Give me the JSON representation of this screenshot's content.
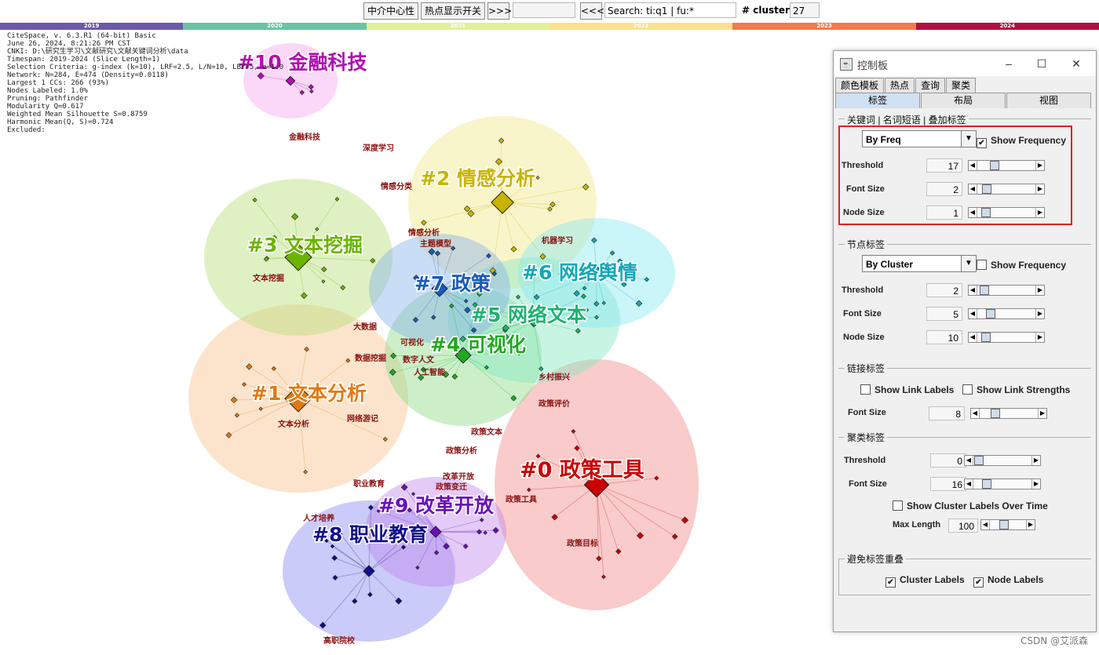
{
  "toolbar": {
    "centrality_btn": "中介中心性",
    "hotspot_btn": "热点显示开关",
    "next_btn": ">>>",
    "blank_field": "",
    "prev_btn": "<<<",
    "search_value": "Search: ti:q1 | fu:*",
    "clusters_label": "# clusters",
    "clusters_value": "27"
  },
  "timeline": {
    "years": [
      "2019",
      "2020",
      "2021",
      "2022",
      "2023",
      "2024"
    ],
    "colors": [
      "#6b5aa8",
      "#6cc3a0",
      "#dff09a",
      "#fde08f",
      "#f47a50",
      "#b01040"
    ]
  },
  "info": {
    "lines": [
      "CiteSpace, v. 6.3.R1 (64-bit) Basic",
      "June 26, 2024, 8:21:26 PM CST",
      "CNKI: D:\\研究生学习\\文献研究\\文献关键词分析\\data",
      "Timespan: 2019-2024 (Slice Length=1)",
      "Selection Criteria: g-index (k=10), LRF=2.5, L/N=10, LBY=5, e=1.0",
      "Network: N=284, E=474 (Density=0.0118)",
      "Largest 1 CCs: 266 (93%)",
      "Nodes Labeled: 1.0%",
      "Pruning: Pathfinder",
      "Modularity Q=0.617",
      "Weighted Mean Silhouette S=0.8759",
      "Harmonic Mean(Q, S)=0.724",
      "Excluded:"
    ]
  },
  "graph": {
    "clusters": [
      {
        "label": "#0 政策工具",
        "color": "#cc0000",
        "blob": "#f28c8c"
      },
      {
        "label": "#1 文本分析",
        "color": "#e07a10",
        "blob": "#f8c48e"
      },
      {
        "label": "#2 情感分析",
        "color": "#c8b400",
        "blob": "#f2e98a"
      },
      {
        "label": "#3 文本挖掘",
        "color": "#6ab400",
        "blob": "#b8e07a"
      },
      {
        "label": "#4 可视化",
        "color": "#22a822",
        "blob": "#8fdc8a"
      },
      {
        "label": "#5 网络文本",
        "color": "#20b070",
        "blob": "#86e8c0"
      },
      {
        "label": "#6 网络舆情",
        "color": "#10a8b8",
        "blob": "#8ae8f2"
      },
      {
        "label": "#7 政策",
        "color": "#1a5ab8",
        "blob": "#8ab4ec"
      },
      {
        "label": "#8 职业教育",
        "color": "#10108a",
        "blob": "#8a8cf0"
      },
      {
        "label": "#9 改革开放",
        "color": "#6a10b8",
        "blob": "#c08aee"
      },
      {
        "label": "#10 金融科技",
        "color": "#b010b0",
        "blob": "#f6a8f0"
      }
    ],
    "node_labels": [
      "情感分析",
      "主题模型",
      "文本挖掘",
      "大数据",
      "数据挖掘",
      "文本分析",
      "网络游记",
      "政策文本",
      "政策工具",
      "政策分析",
      "政策变迁",
      "职业教育",
      "改革开放",
      "深度学习",
      "机器学习",
      "情感分类",
      "可视化",
      "数字人文",
      "人工智能",
      "乡村振兴",
      "政策评价",
      "政策目标",
      "金融科技",
      "高职院校",
      "人才培养"
    ]
  },
  "panel": {
    "title": "控制板",
    "tabs_row1": [
      "颜色模板",
      "热点",
      "查询",
      "聚类"
    ],
    "tabs_row2": [
      "标签",
      "布局",
      "视图"
    ],
    "keyword_group": {
      "title": "关键词 | 名词短语 | 叠加标签",
      "combo": "By Freq",
      "show_frequency": "Show Frequency",
      "show_frequency_checked": "✔",
      "threshold_label": "Threshold",
      "threshold_value": "17",
      "threshold_pos": 0.25,
      "fontsize_label": "Font Size",
      "fontsize_value": "2",
      "fontsize_pos": 0.1,
      "nodesize_label": "Node Size",
      "nodesize_value": "1",
      "nodesize_pos": 0.08
    },
    "node_group": {
      "title": "节点标签",
      "combo": "By Cluster",
      "show_frequency": "Show Frequency",
      "show_frequency_checked": "",
      "threshold_label": "Threshold",
      "threshold_value": "2",
      "threshold_pos": 0.05,
      "fontsize_label": "Font Size",
      "fontsize_value": "5",
      "fontsize_pos": 0.18,
      "nodesize_label": "Node Size",
      "nodesize_value": "10",
      "nodesize_pos": 0.08
    },
    "link_group": {
      "title": "链接标签",
      "show_link_labels": "Show Link Labels",
      "show_link_strengths": "Show Link Strengths",
      "fontsize_label": "Font Size",
      "fontsize_value": "8",
      "fontsize_pos": 0.22
    },
    "cluster_group": {
      "title": "聚类标签",
      "threshold_label": "Threshold",
      "threshold_value": "0",
      "threshold_pos": 0.02,
      "fontsize_label": "Font Size",
      "fontsize_value": "16",
      "fontsize_pos": 0.18,
      "over_time": "Show Cluster Labels Over Time",
      "maxlen_label": "Max Length",
      "maxlen_value": "100",
      "maxlen_pos": 0.35
    },
    "overlap_group": {
      "title": "避免标签重叠",
      "cluster_labels": "Cluster Labels",
      "node_labels": "Node Labels",
      "checked": "✔"
    }
  },
  "watermark": "CSDN @艾派森"
}
